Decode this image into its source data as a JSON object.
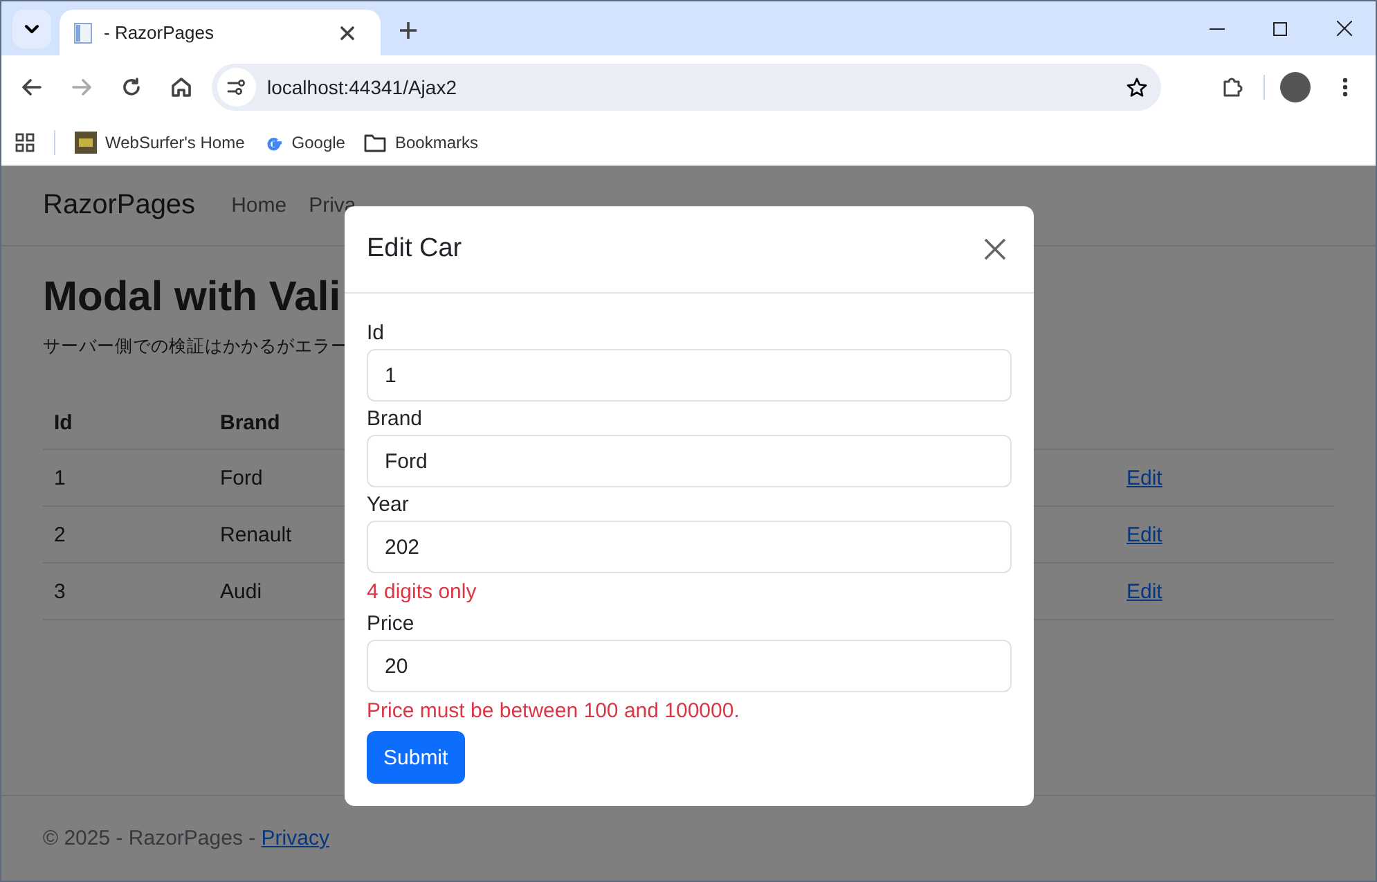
{
  "browser": {
    "tab": {
      "title": "- RazorPages"
    },
    "address": "localhost:44341/Ajax2",
    "bookmarks": [
      {
        "label": "WebSurfer's Home",
        "kind": "site"
      },
      {
        "label": "Google",
        "kind": "google"
      },
      {
        "label": "Bookmarks",
        "kind": "folder"
      }
    ]
  },
  "navbar": {
    "brand": "RazorPages",
    "links": [
      "Home",
      "Priva"
    ]
  },
  "page": {
    "heading": "Modal with Vali",
    "note": "サーバー側での検証はかかるがエラー"
  },
  "table": {
    "columns": [
      "Id",
      "Brand"
    ],
    "rows": [
      {
        "id": "1",
        "brand": "Ford",
        "action": "Edit"
      },
      {
        "id": "2",
        "brand": "Renault",
        "action": "Edit"
      },
      {
        "id": "3",
        "brand": "Audi",
        "action": "Edit"
      }
    ]
  },
  "footer": {
    "text": "© 2025 - RazorPages - ",
    "link": "Privacy"
  },
  "modal": {
    "title": "Edit Car",
    "fields": [
      {
        "label": "Id",
        "value": "1"
      },
      {
        "label": "Brand",
        "value": "Ford"
      },
      {
        "label": "Year",
        "value": "202",
        "error": "4 digits only"
      },
      {
        "label": "Price",
        "value": "20",
        "error": "Price must be between 100 and 100000."
      }
    ],
    "submit": "Submit"
  }
}
